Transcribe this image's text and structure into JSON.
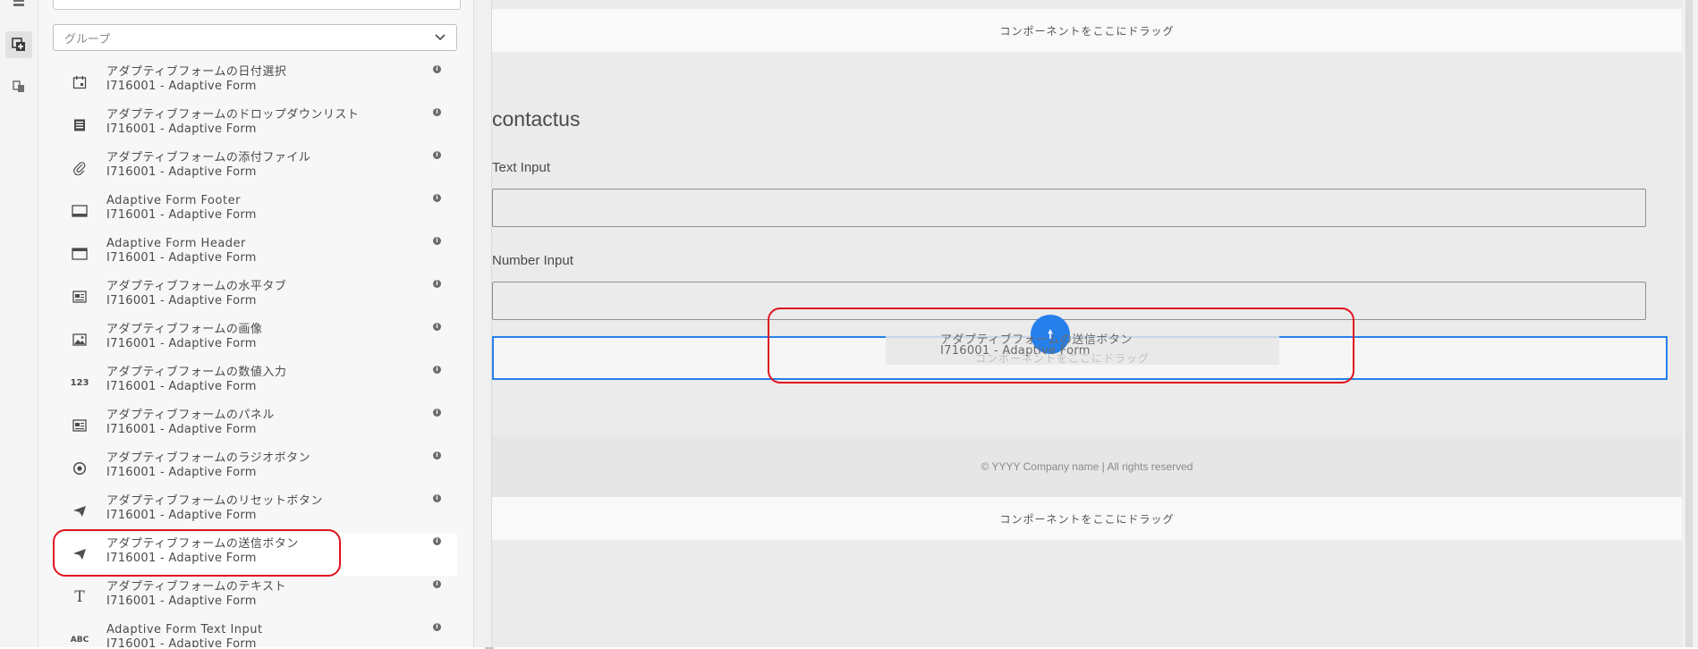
{
  "rail": {
    "items": [
      {
        "icon": "layers-icon"
      },
      {
        "icon": "components-add-icon"
      },
      {
        "icon": "assets-icon"
      }
    ]
  },
  "panel": {
    "group_placeholder": "グループ",
    "components": [
      {
        "title": "アダプティブフォームの日付選択",
        "group": "I716001 - Adaptive Form",
        "icon": "calendar-icon"
      },
      {
        "title": "アダプティブフォームのドロップダウンリスト",
        "group": "I716001 - Adaptive Form",
        "icon": "dropdown-list-icon"
      },
      {
        "title": "アダプティブフォームの添付ファイル",
        "group": "I716001 - Adaptive Form",
        "icon": "paperclip-icon"
      },
      {
        "title": "Adaptive Form Footer",
        "group": "I716001 - Adaptive Form",
        "icon": "footer-icon"
      },
      {
        "title": "Adaptive Form Header",
        "group": "I716001 - Adaptive Form",
        "icon": "header-icon"
      },
      {
        "title": "アダプティブフォームの水平タブ",
        "group": "I716001 - Adaptive Form",
        "icon": "tabs-icon"
      },
      {
        "title": "アダプティブフォームの画像",
        "group": "I716001 - Adaptive Form",
        "icon": "image-icon"
      },
      {
        "title": "アダプティブフォームの数値入力",
        "group": "I716001 - Adaptive Form",
        "icon": "number-icon",
        "glyph": "123"
      },
      {
        "title": "アダプティブフォームのパネル",
        "group": "I716001 - Adaptive Form",
        "icon": "panel-icon"
      },
      {
        "title": "アダプティブフォームのラジオボタン",
        "group": "I716001 - Adaptive Form",
        "icon": "radio-icon"
      },
      {
        "title": "アダプティブフォームのリセットボタン",
        "group": "I716001 - Adaptive Form",
        "icon": "send-icon"
      },
      {
        "title": "アダプティブフォームの送信ボタン",
        "group": "I716001 - Adaptive Form",
        "icon": "send-icon"
      },
      {
        "title": "アダプティブフォームのテキスト",
        "group": "I716001 - Adaptive Form",
        "icon": "text-icon",
        "glyph": "T"
      },
      {
        "title": "Adaptive Form Text Input",
        "group": "I716001 - Adaptive Form",
        "icon": "text-input-icon",
        "glyph": "ABC"
      }
    ]
  },
  "canvas": {
    "drop_placeholder_top": "コンポーネントをここにドラッグ",
    "form_title": "contactus",
    "fields": [
      {
        "label": "Text Input"
      },
      {
        "label": "Number Input"
      }
    ],
    "submit_drop_placeholder": "コンポーネントをここにドラッグ",
    "dragging": {
      "title": "アダプティブフォームの送信ボタン",
      "group": "I716001 - Adaptive Form"
    },
    "footer_text": "© YYYY Company name | All rights reserved",
    "drop_placeholder_bottom": "コンポーネントをここにドラッグ"
  },
  "colors": {
    "accent": "#2680eb",
    "highlight": "#e0141e"
  }
}
